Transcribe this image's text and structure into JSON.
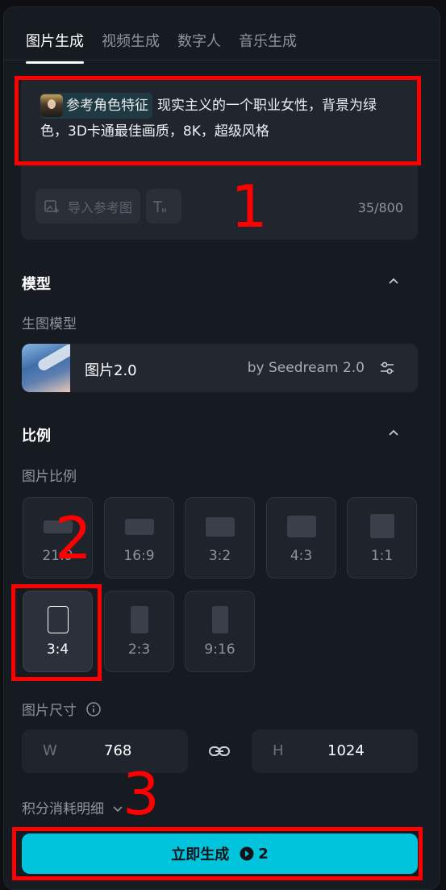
{
  "tabs": [
    {
      "label": "图片生成",
      "active": true
    },
    {
      "label": "视频生成",
      "active": false
    },
    {
      "label": "数字人",
      "active": false
    },
    {
      "label": "音乐生成",
      "active": false
    }
  ],
  "prompt": {
    "chip_label": "参考角色特征",
    "text": "现实主义的一个职业女性，背景为绿色，3D卡通最佳画质，8K，超级风格",
    "import_button": "导入参考图",
    "counter": "35/800"
  },
  "model_section": {
    "title": "模型",
    "sub_label": "生图模型",
    "model_name": "图片2.0",
    "model_by": "by Seedream 2.0"
  },
  "ratio_section": {
    "title": "比例",
    "sub_label": "图片比例",
    "options": [
      "21:9",
      "16:9",
      "3:2",
      "4:3",
      "1:1",
      "3:4",
      "2:3",
      "9:16"
    ],
    "selected": "3:4"
  },
  "size_section": {
    "label": "图片尺寸",
    "width_prefix": "W",
    "width_value": "768",
    "height_prefix": "H",
    "height_value": "1024"
  },
  "credit_label": "积分消耗明细",
  "generate_button": {
    "label": "立即生成",
    "cost": "2"
  },
  "annotations": {
    "n1": "1",
    "n2": "2",
    "n3": "3",
    "color": "#ff0000"
  },
  "colors": {
    "accent": "#00c4dc",
    "panel": "#161a21",
    "card": "#232830"
  }
}
